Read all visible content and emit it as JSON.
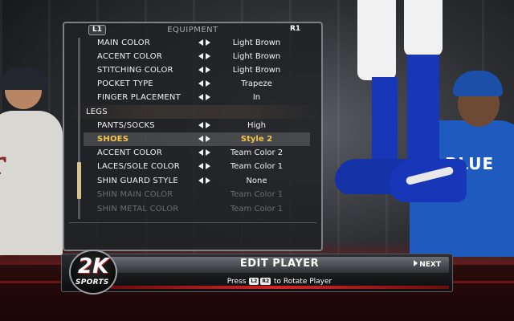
{
  "panel": {
    "left_shoulder": "L1",
    "title": "EQUIPMENT",
    "right_shoulder": "R1",
    "rows": [
      {
        "label": "MAIN COLOR",
        "value": "Light Brown"
      },
      {
        "label": "ACCENT COLOR",
        "value": "Light Brown"
      },
      {
        "label": "STITCHING COLOR",
        "value": "Light Brown"
      },
      {
        "label": "POCKET TYPE",
        "value": "Trapeze"
      },
      {
        "label": "FINGER PLACEMENT",
        "value": "In"
      },
      {
        "label": "LEGS",
        "value": ""
      },
      {
        "label": "PANTS/SOCKS",
        "value": "High"
      },
      {
        "label": "SHOES",
        "value": "Style 2"
      },
      {
        "label": "ACCENT COLOR",
        "value": "Team Color 2"
      },
      {
        "label": "LACES/SOLE COLOR",
        "value": "Team Color 1"
      },
      {
        "label": "SHIN GUARD STYLE",
        "value": "None"
      },
      {
        "label": "SHIN MAIN COLOR",
        "value": "Team Color 1"
      },
      {
        "label": "SHIN METAL COLOR",
        "value": "Team Color 1"
      }
    ]
  },
  "bottom_bar": {
    "title": "EDIT PLAYER",
    "next_label": "NEXT",
    "hint_prefix": "Press",
    "key_l2": "L2",
    "key_r2": "R2",
    "hint_suffix": "to Rotate Player"
  },
  "logo": {
    "brand": "2K",
    "sub": "SPORTS"
  },
  "background": {
    "right_player_jersey": "BLUE"
  },
  "colors": {
    "selected_text": "#f6c548",
    "panel_bg": "#202124",
    "accent_red": "#d32626"
  }
}
